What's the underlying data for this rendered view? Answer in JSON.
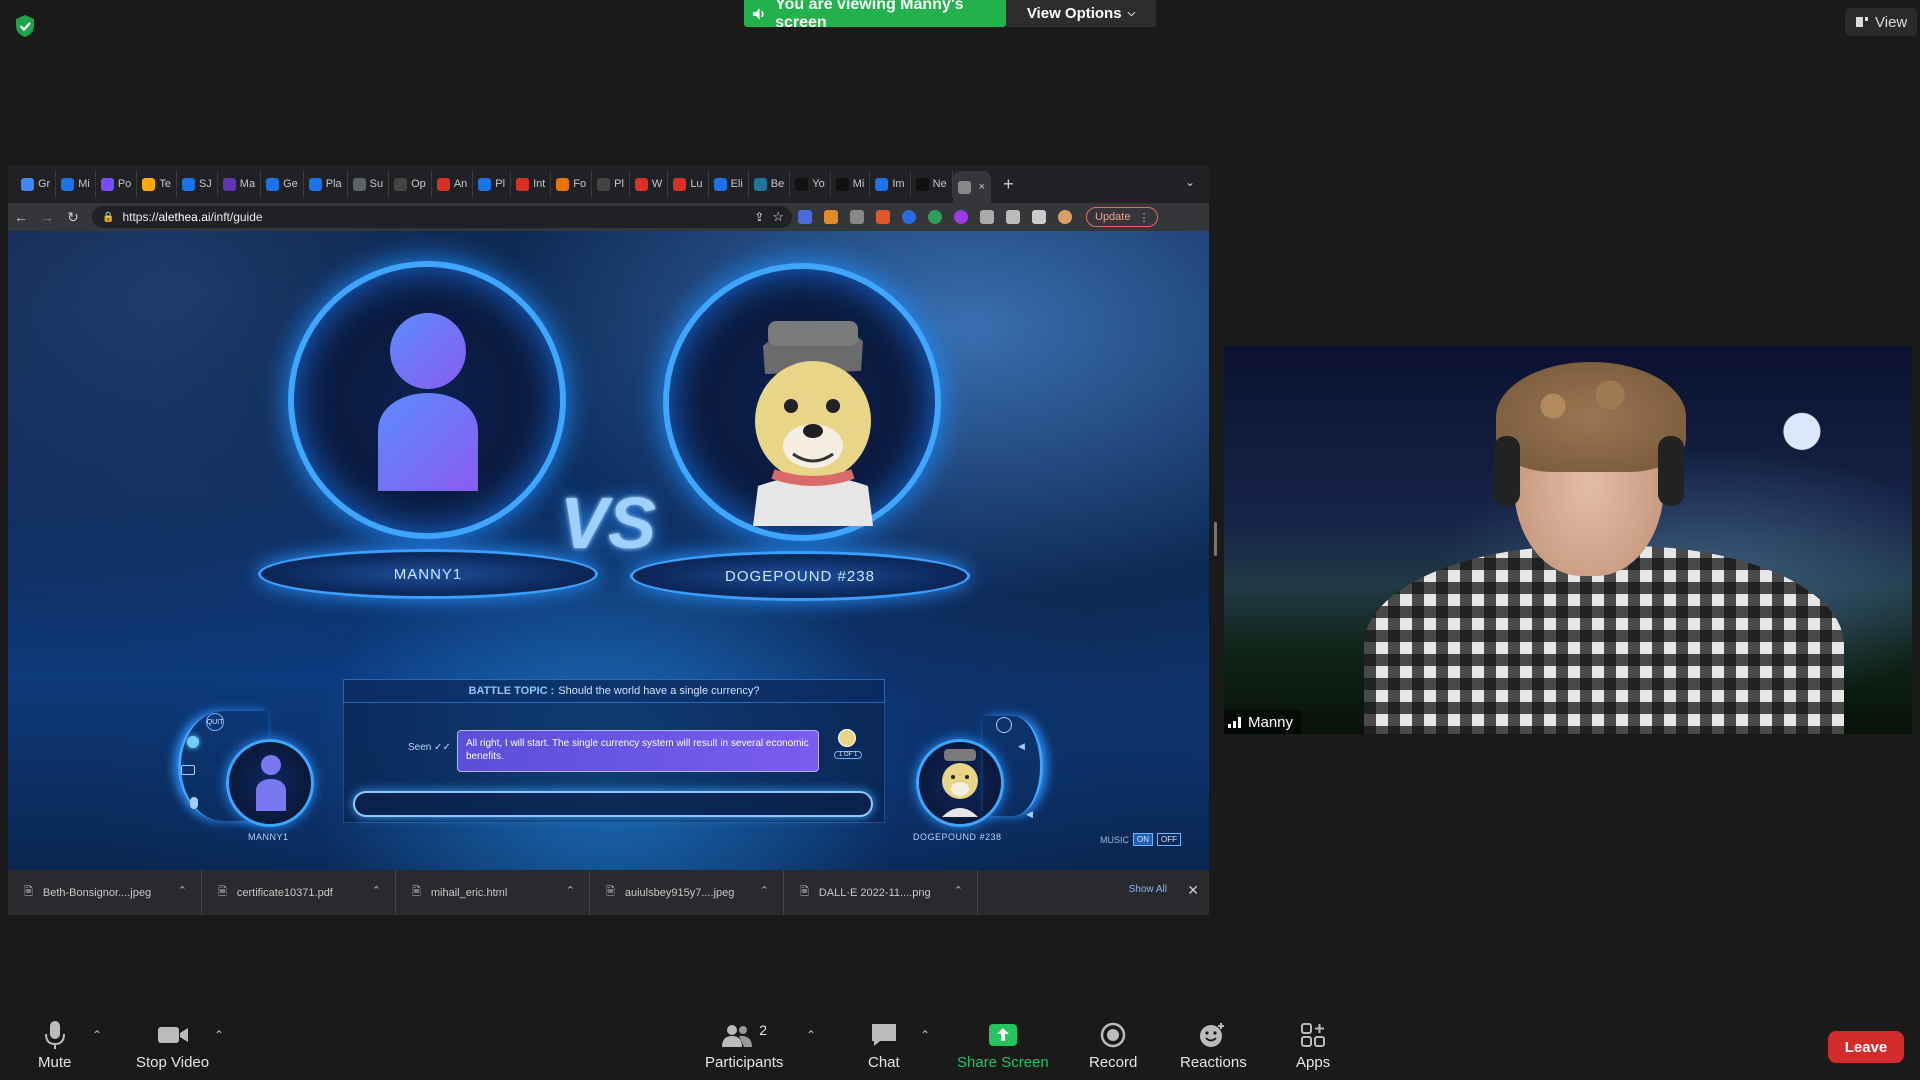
{
  "banner": {
    "text": "You are viewing Manny's screen",
    "view_options": "View Options"
  },
  "view_button": "View",
  "browser": {
    "tabs": [
      "Gr",
      "Mi",
      "Po",
      "Te",
      "SJ",
      "Ma",
      "Ge",
      "Pla",
      "Su",
      "Op",
      "An",
      "Pl",
      "Int",
      "Fo",
      "Pl",
      "W",
      "Lu",
      "Eli",
      "Be",
      "Yo",
      "Mi",
      "Im",
      "Ne",
      ""
    ],
    "url": "https://alethea.ai/inft/guide",
    "url_host": "alethea.ai",
    "url_scheme": "https://",
    "url_path": "/inft/guide",
    "update_label": "Update"
  },
  "game": {
    "left_name": "MANNY1",
    "right_name": "DOGEPOUND #238",
    "vs": "VS",
    "battle_topic_label": "BATTLE TOPIC :",
    "battle_topic": "Should the world have a single currency?",
    "message": "All right, I will start. The single currency system will result in several economic benefits.",
    "seen": "Seen",
    "page_indicator": "1 OF 1",
    "small_left_name": "MANNY1",
    "small_right_name": "DOGEPOUND #238",
    "music_label": "MUSIC",
    "music_on": "ON",
    "music_off": "OFF"
  },
  "downloads": {
    "items": [
      "Beth-Bonsignor....jpeg",
      "certificate10371.pdf",
      "mihail_eric.html",
      "auiulsbey915y7....jpeg",
      "DALL·E 2022-11....png"
    ],
    "show_all": "Show All"
  },
  "participant": {
    "name": "Manny"
  },
  "controls": {
    "mute": "Mute",
    "stop_video": "Stop Video",
    "participants": "Participants",
    "participants_count": "2",
    "chat": "Chat",
    "share_screen": "Share Screen",
    "record": "Record",
    "reactions": "Reactions",
    "apps": "Apps",
    "leave": "Leave"
  },
  "colors": {
    "banner_green": "#22b14c",
    "leave_red": "#d12b2b",
    "share_green": "#22c55e"
  }
}
